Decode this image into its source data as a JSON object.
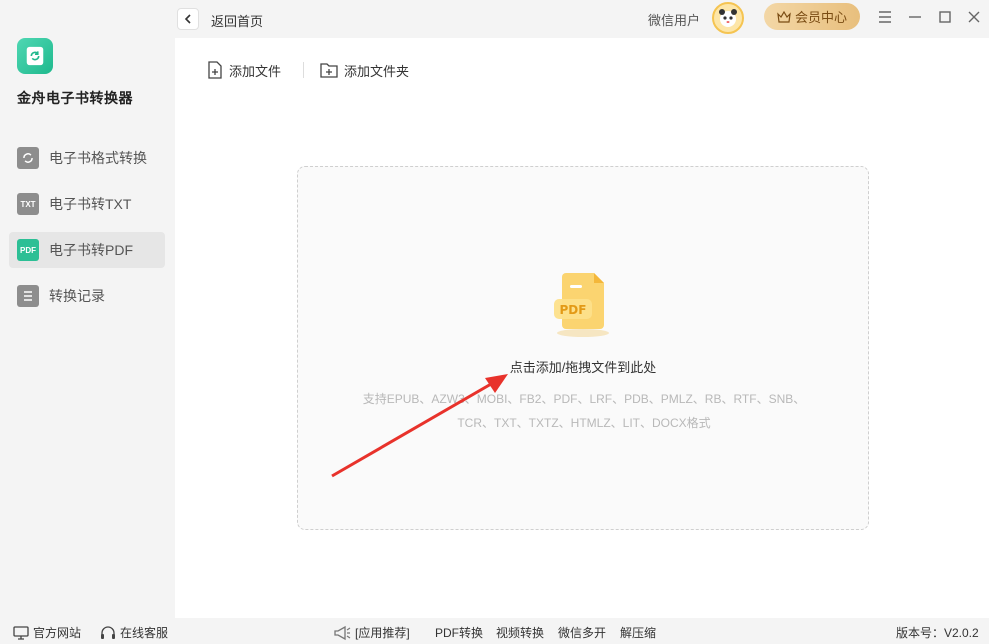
{
  "app": {
    "name": "金舟电子书转换器",
    "accent": "#2cbf95"
  },
  "sidebar": {
    "items": [
      {
        "label": "电子书格式转换",
        "icon": "refresh-icon",
        "badge": ""
      },
      {
        "label": "电子书转TXT",
        "icon": "txt-icon",
        "badge": "TXT"
      },
      {
        "label": "电子书转PDF",
        "icon": "pdf-icon",
        "badge": "PDF",
        "active": true
      },
      {
        "label": "转换记录",
        "icon": "record-icon",
        "badge": ""
      }
    ]
  },
  "header": {
    "back_label": "返回首页",
    "user_name": "微信用户",
    "vip_label": "会员中心"
  },
  "toolbar": {
    "add_file": "添加文件",
    "add_folder": "添加文件夹"
  },
  "dropzone": {
    "title": "点击添加/拖拽文件到此处",
    "formats_line1": "支持EPUB、AZW3、MOBI、FB2、PDF、LRF、PDB、PMLZ、RB、RTF、SNB、",
    "formats_line2": "TCR、TXT、TXTZ、HTMLZ、LIT、DOCX格式",
    "icon_text": "PDF"
  },
  "footer": {
    "website": "官方网站",
    "support": "在线客服",
    "recommend": "[应用推荐]",
    "links": [
      "PDF转换",
      "视频转换",
      "微信多开",
      "解压缩"
    ],
    "version": "版本号：V2.0.2"
  }
}
